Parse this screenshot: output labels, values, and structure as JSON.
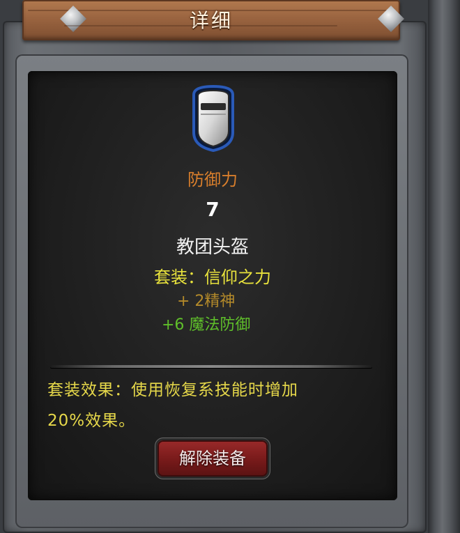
{
  "window": {
    "title": "详细"
  },
  "item": {
    "icon": "helmet-icon",
    "stat_label": "防御力",
    "stat_value": "7",
    "name": "教团头盔",
    "set_name": "套装：信仰之力",
    "bonuses": [
      "+ 2精神",
      "+6 魔法防御"
    ]
  },
  "set_effect": {
    "line1": "套装效果：使用恢复系技能时增加",
    "line2": "20%效果。"
  },
  "actions": {
    "unequip_label": "解除装备"
  },
  "colors": {
    "stat_label": "#d87e2c",
    "set_name": "#e8e23c",
    "bonus_stat": "#b48a2a",
    "bonus_magic": "#5fbf2a",
    "effect_text": "#e6d84a",
    "button": "#7a1b1b"
  }
}
